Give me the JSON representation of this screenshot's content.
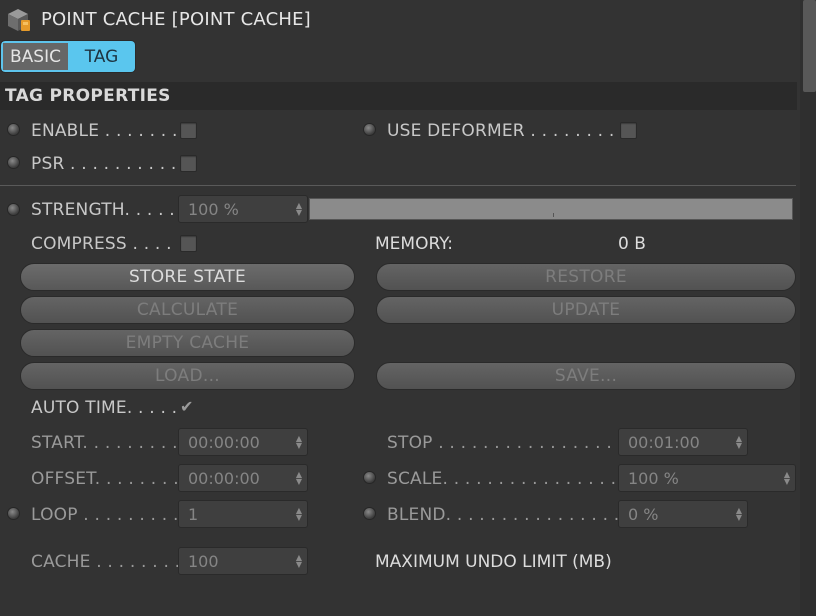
{
  "header": {
    "title": "POINT CACHE [POINT CACHE]",
    "icon": "point-cache-icon"
  },
  "tabs": [
    {
      "label": "BASIC",
      "active": false
    },
    {
      "label": "TAG",
      "active": true
    }
  ],
  "section": {
    "title": "TAG PROPERTIES"
  },
  "params": {
    "enable": {
      "label": "ENABLE . . . . . . . .",
      "checked": false
    },
    "use_deformer": {
      "label": "USE DEFORMER . . . . . . . . .",
      "checked": false
    },
    "psr": {
      "label": "PSR . . . . . . . . . . .",
      "checked": false
    },
    "strength": {
      "label": "STRENGTH. . . . .",
      "value": "100 %"
    },
    "compress": {
      "label": "COMPRESS . . . .",
      "checked": false
    },
    "memory": {
      "label": "MEMORY:",
      "value": "0 B"
    },
    "auto_time": {
      "label": "AUTO TIME. . . . .",
      "checked": true
    },
    "start": {
      "label": "START. . . . . . . . .",
      "value": "00:00:00"
    },
    "stop": {
      "label": "STOP . . . . . . . . . . . . . . . . .",
      "value": "00:01:00"
    },
    "offset": {
      "label": "OFFSET. . . . . . . .",
      "value": "00:00:00"
    },
    "scale": {
      "label": "SCALE. . . . . . . . . . . . . . . . .",
      "value": "100 %"
    },
    "loop": {
      "label": "LOOP . . . . . . . . .",
      "value": "1"
    },
    "blend": {
      "label": "BLEND. . . . . . . . . . . . . . . . .",
      "value": "0 %"
    },
    "cache": {
      "label": "CACHE . . . . . . . .",
      "value": "100"
    },
    "max_undo": {
      "label": "MAXIMUM UNDO LIMIT (MB)"
    }
  },
  "buttons": {
    "store_state": "STORE STATE",
    "restore": "RESTORE",
    "calculate": "CALCULATE",
    "update": "UPDATE",
    "empty_cache": "EMPTY CACHE",
    "load": "LOAD...",
    "save": "SAVE..."
  },
  "colors": {
    "background": "#333333",
    "accent": "#5ac6ee"
  }
}
